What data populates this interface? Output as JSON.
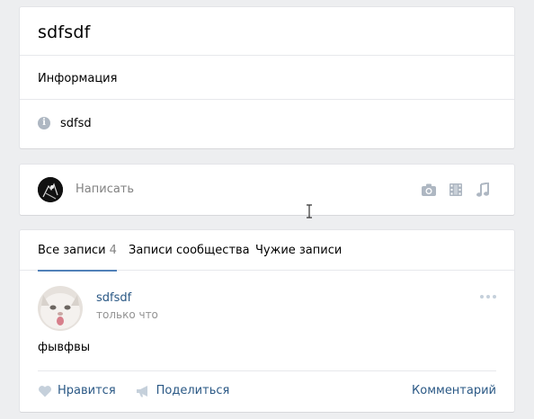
{
  "group": {
    "name": "sdfsdf",
    "info_title": "Информация",
    "description": "sdfsd"
  },
  "composer": {
    "placeholder": "Написать",
    "tools": [
      "camera-icon",
      "video-icon",
      "music-icon"
    ]
  },
  "wall": {
    "tabs": [
      {
        "label": "Все записи",
        "count": "4",
        "active": true
      },
      {
        "label": "Записи сообщества",
        "active": false
      },
      {
        "label": "Чужие записи",
        "active": false
      }
    ],
    "post": {
      "author": "sdfsdf",
      "time": "только что",
      "text": "фывфвы",
      "like_label": "Нравится",
      "share_label": "Поделиться",
      "comment_label": "Комментарий"
    }
  },
  "colors": {
    "page_bg": "#edeef0",
    "link": "#2a5885",
    "accent": "#5181b8",
    "muted": "#828282",
    "icon_gray": "#aeb7c2"
  }
}
